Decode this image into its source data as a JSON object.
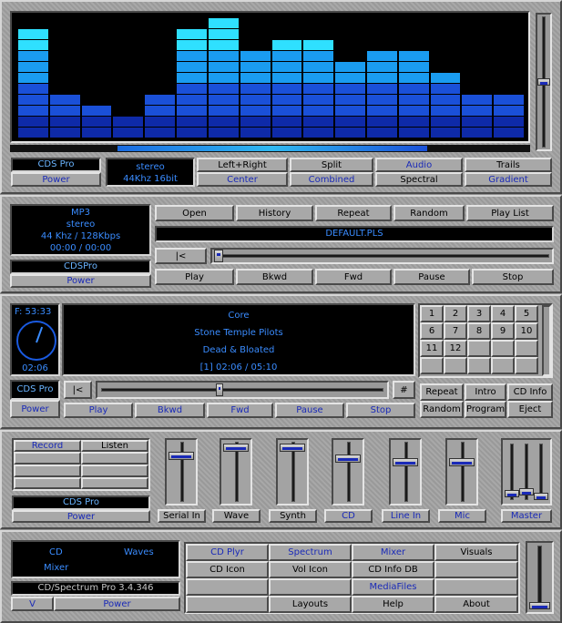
{
  "spectrum": {
    "bars": [
      0.92,
      0.4,
      0.3,
      0.2,
      0.4,
      0.93,
      1.0,
      0.7,
      0.8,
      0.8,
      0.6,
      0.7,
      0.7,
      0.5,
      0.4,
      0.4
    ],
    "colors": {
      "top": "#2fe0ff",
      "mid": "#1a9cf0",
      "low": "#1a50d8",
      "bottom": "#0e2aa8"
    },
    "volume_level": 0.5,
    "title": "CDS Pro",
    "power": "Power",
    "channel": "stereo",
    "rate": "44Khz 16bit",
    "buttons": [
      [
        "Left+Right",
        "Split",
        "Audio",
        "Trails"
      ],
      [
        "Center",
        "Combined",
        "Spectral",
        "Gradient"
      ]
    ]
  },
  "mp3": {
    "lcd": [
      "MP3",
      "stereo",
      "44 Khz / 128Kbps",
      "00:00 / 00:00"
    ],
    "title": "CDSPro",
    "power": "Power",
    "top_buttons": [
      "Open",
      "History",
      "Repeat",
      "Random",
      "Play List"
    ],
    "playlist": "DEFAULT.PLS",
    "seek_back": "|<",
    "bottom_buttons": [
      "Play",
      "Bkwd",
      "Fwd",
      "Pause",
      "Stop"
    ]
  },
  "cd": {
    "frame": "F: 53:33",
    "elapsed": "02:06",
    "track_title": "Core",
    "artist": "Stone Temple Pilots",
    "song": "Dead & Bloated",
    "position": "[1] 02:06 / 05:10",
    "title": "CDS Pro",
    "power": "Power",
    "seek_back": "|<",
    "hash": "#",
    "seek_level": 0.42,
    "transport": [
      "Play",
      "Bkwd",
      "Fwd",
      "Pause",
      "Stop"
    ],
    "tracks": [
      "1",
      "2",
      "3",
      "4",
      "5",
      "6",
      "7",
      "8",
      "9",
      "10",
      "11",
      "12"
    ],
    "mode_buttons": [
      [
        "Repeat",
        "Intro",
        "CD Info"
      ],
      [
        "Random",
        "Program",
        "Eject"
      ]
    ]
  },
  "mixer": {
    "record": "Record",
    "listen": "Listen",
    "title": "CDS Pro",
    "power": "Power",
    "channels": [
      {
        "label": "Serial In",
        "level": 0.82
      },
      {
        "label": "Wave",
        "level": 0.96
      },
      {
        "label": "Synth",
        "level": 0.96
      },
      {
        "label": "CD",
        "level": 0.77
      },
      {
        "label": "Line In",
        "level": 0.7
      },
      {
        "label": "Mic",
        "level": 0.7
      }
    ],
    "master_label": "Master",
    "master_levels": [
      0.08,
      0.12,
      0.04
    ]
  },
  "launcher": {
    "lcd": {
      "left": "CD",
      "right": "Waves",
      "bottom": "Mixer"
    },
    "version": "CD/Spectrum Pro 3.4.346",
    "v": "V",
    "power": "Power",
    "grid": [
      [
        "CD Plyr",
        "Spectrum",
        "Mixer",
        "Visuals"
      ],
      [
        "CD Icon",
        "Vol Icon",
        "CD Info DB",
        ""
      ],
      [
        "",
        "",
        "MediaFiles",
        ""
      ],
      [
        "",
        "Layouts",
        "Help",
        "About"
      ]
    ],
    "volume_level": 0.05
  }
}
